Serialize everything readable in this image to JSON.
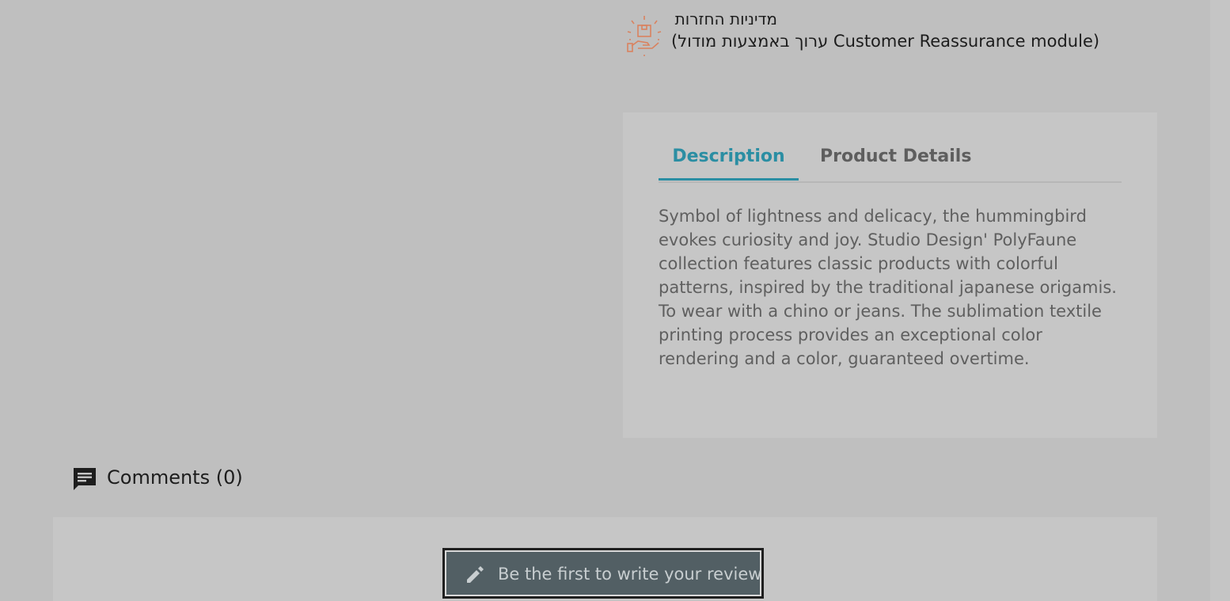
{
  "reassurance": {
    "title": "מדיניות החזרות",
    "description": "(ערוך באמצעות מודול Customer Reassurance module)",
    "icon": "package-hand-icon",
    "icon_color": "#d9825f"
  },
  "tabs": {
    "items": [
      {
        "label": "Description",
        "active": true
      },
      {
        "label": "Product Details",
        "active": false
      }
    ],
    "accent_color": "#2b8ea3"
  },
  "description": {
    "text": "Symbol of lightness and delicacy, the hummingbird evokes curiosity and joy. Studio Design' PolyFaune collection features classic products with colorful patterns, inspired by the traditional japanese origamis. To wear with a chino or jeans. The sublimation textile printing process provides an exceptional color rendering and a color, guaranteed overtime."
  },
  "comments": {
    "title": "Comments (0)",
    "icon": "comment-icon"
  },
  "review": {
    "button_label": "Be the first to write your review",
    "icon": "pencil-icon"
  }
}
